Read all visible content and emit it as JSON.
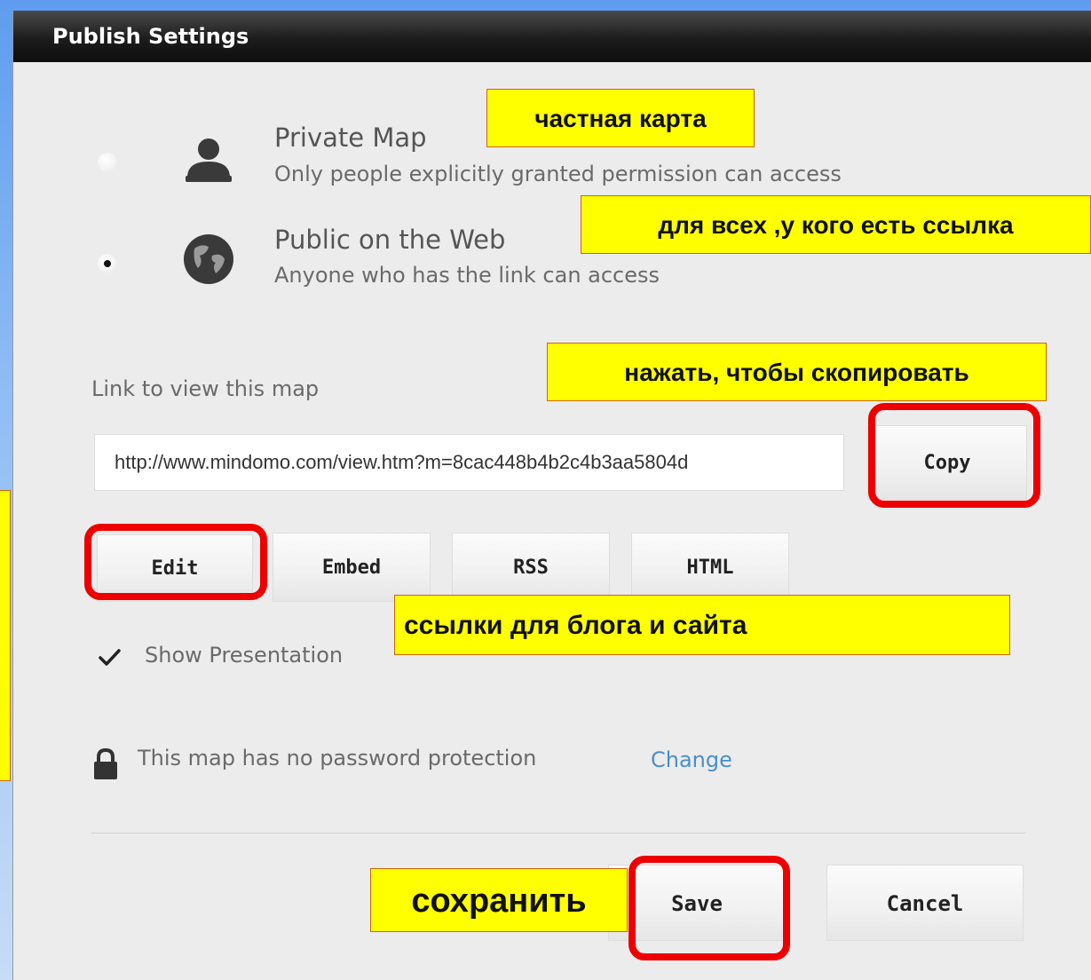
{
  "dialog": {
    "title": "Publish Settings"
  },
  "privacy": {
    "private": {
      "title": "Private Map",
      "description": "Only people explicitly granted permission can access",
      "selected": false,
      "icon": "person-icon"
    },
    "public": {
      "title": "Public on the Web",
      "description": "Anyone who has the link can access",
      "selected": true,
      "icon": "globe-icon"
    }
  },
  "link": {
    "label": "Link to view this map",
    "value": "http://www.mindomo.com/view.htm?m=8cac448b4b2c4b3aa5804d",
    "copy_label": "Copy"
  },
  "link_tabs": [
    "Edit",
    "Embed",
    "RSS",
    "HTML"
  ],
  "show_presentation": {
    "label": "Show Presentation",
    "checked": true
  },
  "password": {
    "text": "This map has no password protection",
    "change_label": "Change",
    "icon": "lock-icon"
  },
  "actions": {
    "save_label": "Save",
    "cancel_label": "Cancel"
  },
  "annotations": {
    "private_map": "частная карта",
    "public_link": "для всех ,у кого есть ссылка",
    "copy_hint": "нажать, чтобы скопировать",
    "blog_links": "ссылки  для блога и сайта",
    "save_hint": "сохранить"
  },
  "colors": {
    "note_background": "#ffff00",
    "highlight_border": "#ee0000",
    "link_color": "#4a8fc7",
    "titlebar": "#1c1c1c"
  }
}
